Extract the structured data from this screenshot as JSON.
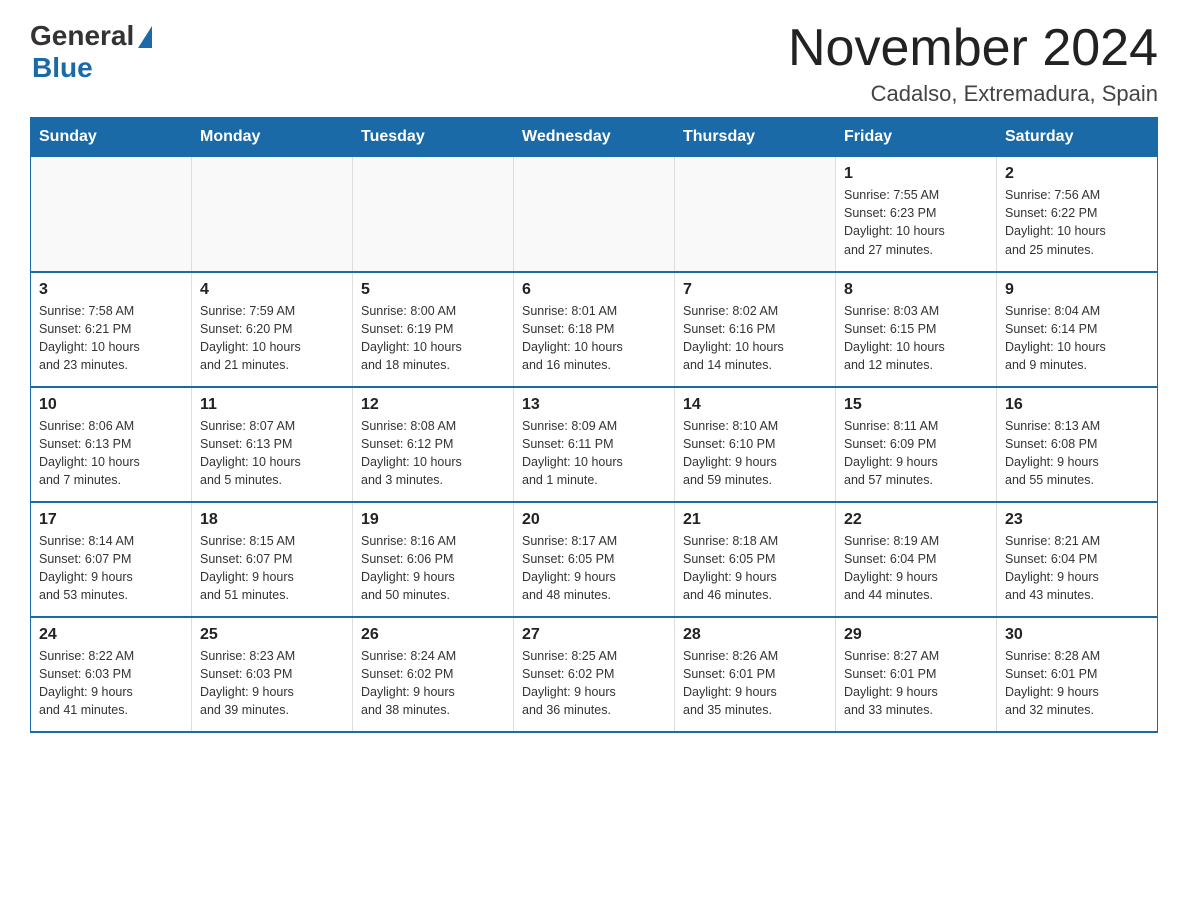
{
  "logo": {
    "general": "General",
    "blue": "Blue"
  },
  "header": {
    "month": "November 2024",
    "location": "Cadalso, Extremadura, Spain"
  },
  "weekdays": [
    "Sunday",
    "Monday",
    "Tuesday",
    "Wednesday",
    "Thursday",
    "Friday",
    "Saturday"
  ],
  "weeks": [
    [
      {
        "day": "",
        "info": ""
      },
      {
        "day": "",
        "info": ""
      },
      {
        "day": "",
        "info": ""
      },
      {
        "day": "",
        "info": ""
      },
      {
        "day": "",
        "info": ""
      },
      {
        "day": "1",
        "info": "Sunrise: 7:55 AM\nSunset: 6:23 PM\nDaylight: 10 hours\nand 27 minutes."
      },
      {
        "day": "2",
        "info": "Sunrise: 7:56 AM\nSunset: 6:22 PM\nDaylight: 10 hours\nand 25 minutes."
      }
    ],
    [
      {
        "day": "3",
        "info": "Sunrise: 7:58 AM\nSunset: 6:21 PM\nDaylight: 10 hours\nand 23 minutes."
      },
      {
        "day": "4",
        "info": "Sunrise: 7:59 AM\nSunset: 6:20 PM\nDaylight: 10 hours\nand 21 minutes."
      },
      {
        "day": "5",
        "info": "Sunrise: 8:00 AM\nSunset: 6:19 PM\nDaylight: 10 hours\nand 18 minutes."
      },
      {
        "day": "6",
        "info": "Sunrise: 8:01 AM\nSunset: 6:18 PM\nDaylight: 10 hours\nand 16 minutes."
      },
      {
        "day": "7",
        "info": "Sunrise: 8:02 AM\nSunset: 6:16 PM\nDaylight: 10 hours\nand 14 minutes."
      },
      {
        "day": "8",
        "info": "Sunrise: 8:03 AM\nSunset: 6:15 PM\nDaylight: 10 hours\nand 12 minutes."
      },
      {
        "day": "9",
        "info": "Sunrise: 8:04 AM\nSunset: 6:14 PM\nDaylight: 10 hours\nand 9 minutes."
      }
    ],
    [
      {
        "day": "10",
        "info": "Sunrise: 8:06 AM\nSunset: 6:13 PM\nDaylight: 10 hours\nand 7 minutes."
      },
      {
        "day": "11",
        "info": "Sunrise: 8:07 AM\nSunset: 6:13 PM\nDaylight: 10 hours\nand 5 minutes."
      },
      {
        "day": "12",
        "info": "Sunrise: 8:08 AM\nSunset: 6:12 PM\nDaylight: 10 hours\nand 3 minutes."
      },
      {
        "day": "13",
        "info": "Sunrise: 8:09 AM\nSunset: 6:11 PM\nDaylight: 10 hours\nand 1 minute."
      },
      {
        "day": "14",
        "info": "Sunrise: 8:10 AM\nSunset: 6:10 PM\nDaylight: 9 hours\nand 59 minutes."
      },
      {
        "day": "15",
        "info": "Sunrise: 8:11 AM\nSunset: 6:09 PM\nDaylight: 9 hours\nand 57 minutes."
      },
      {
        "day": "16",
        "info": "Sunrise: 8:13 AM\nSunset: 6:08 PM\nDaylight: 9 hours\nand 55 minutes."
      }
    ],
    [
      {
        "day": "17",
        "info": "Sunrise: 8:14 AM\nSunset: 6:07 PM\nDaylight: 9 hours\nand 53 minutes."
      },
      {
        "day": "18",
        "info": "Sunrise: 8:15 AM\nSunset: 6:07 PM\nDaylight: 9 hours\nand 51 minutes."
      },
      {
        "day": "19",
        "info": "Sunrise: 8:16 AM\nSunset: 6:06 PM\nDaylight: 9 hours\nand 50 minutes."
      },
      {
        "day": "20",
        "info": "Sunrise: 8:17 AM\nSunset: 6:05 PM\nDaylight: 9 hours\nand 48 minutes."
      },
      {
        "day": "21",
        "info": "Sunrise: 8:18 AM\nSunset: 6:05 PM\nDaylight: 9 hours\nand 46 minutes."
      },
      {
        "day": "22",
        "info": "Sunrise: 8:19 AM\nSunset: 6:04 PM\nDaylight: 9 hours\nand 44 minutes."
      },
      {
        "day": "23",
        "info": "Sunrise: 8:21 AM\nSunset: 6:04 PM\nDaylight: 9 hours\nand 43 minutes."
      }
    ],
    [
      {
        "day": "24",
        "info": "Sunrise: 8:22 AM\nSunset: 6:03 PM\nDaylight: 9 hours\nand 41 minutes."
      },
      {
        "day": "25",
        "info": "Sunrise: 8:23 AM\nSunset: 6:03 PM\nDaylight: 9 hours\nand 39 minutes."
      },
      {
        "day": "26",
        "info": "Sunrise: 8:24 AM\nSunset: 6:02 PM\nDaylight: 9 hours\nand 38 minutes."
      },
      {
        "day": "27",
        "info": "Sunrise: 8:25 AM\nSunset: 6:02 PM\nDaylight: 9 hours\nand 36 minutes."
      },
      {
        "day": "28",
        "info": "Sunrise: 8:26 AM\nSunset: 6:01 PM\nDaylight: 9 hours\nand 35 minutes."
      },
      {
        "day": "29",
        "info": "Sunrise: 8:27 AM\nSunset: 6:01 PM\nDaylight: 9 hours\nand 33 minutes."
      },
      {
        "day": "30",
        "info": "Sunrise: 8:28 AM\nSunset: 6:01 PM\nDaylight: 9 hours\nand 32 minutes."
      }
    ]
  ]
}
